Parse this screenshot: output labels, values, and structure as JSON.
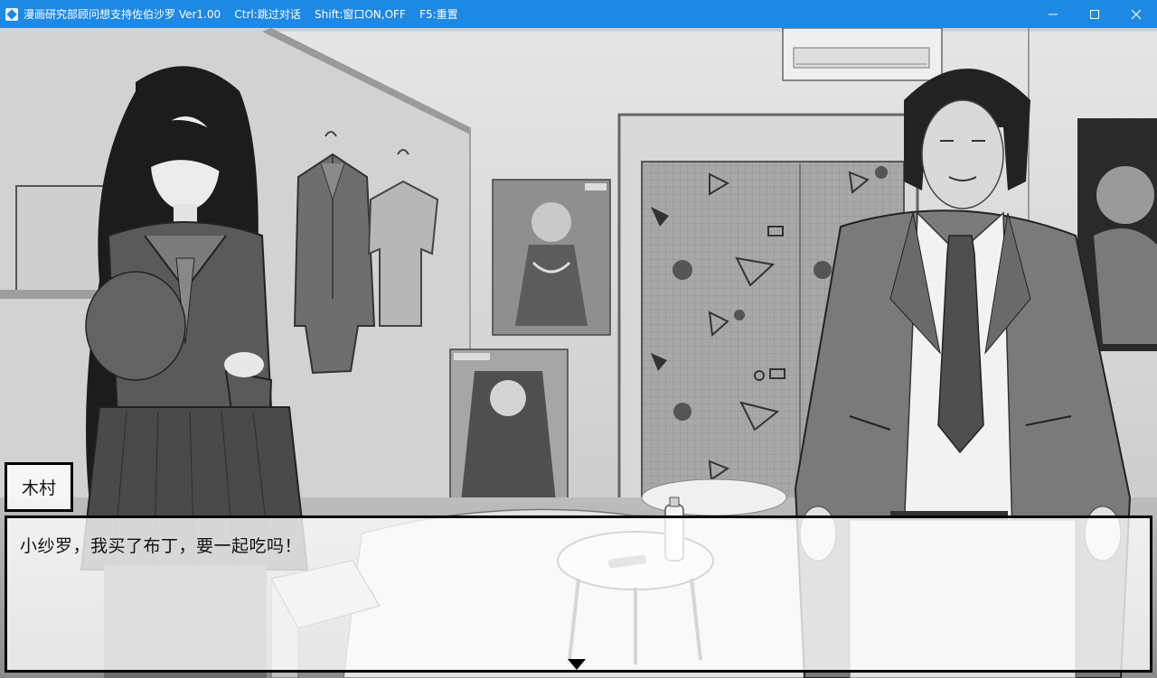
{
  "window": {
    "title": "漫画研究部顾问想支持佐伯沙罗 Ver1.00    Ctrl:跳过对话    Shift:窗口ON,OFF    F5:重置",
    "controls": {
      "minimize_icon": "minimize-icon",
      "maximize_icon": "maximize-icon",
      "close_icon": "close-icon"
    },
    "colors": {
      "titlebar": "#1e88e5",
      "title_text": "#ffffff"
    }
  },
  "scene": {
    "style": "grayscale",
    "elements": [
      "room-background",
      "air-conditioner",
      "hanging-jacket",
      "hanging-shirt",
      "poster-warrior-girl",
      "poster-nun-girl",
      "patterned-curtain",
      "poster-right-edge",
      "schoolgirl-character",
      "teacher-character",
      "bed",
      "round-stool",
      "water-bottle",
      "cardboard-box"
    ]
  },
  "dialogue": {
    "speaker": "木村",
    "text": "小纱罗，我买了布丁，要一起吃吗！",
    "advance_icon": "triangle-down-icon"
  }
}
